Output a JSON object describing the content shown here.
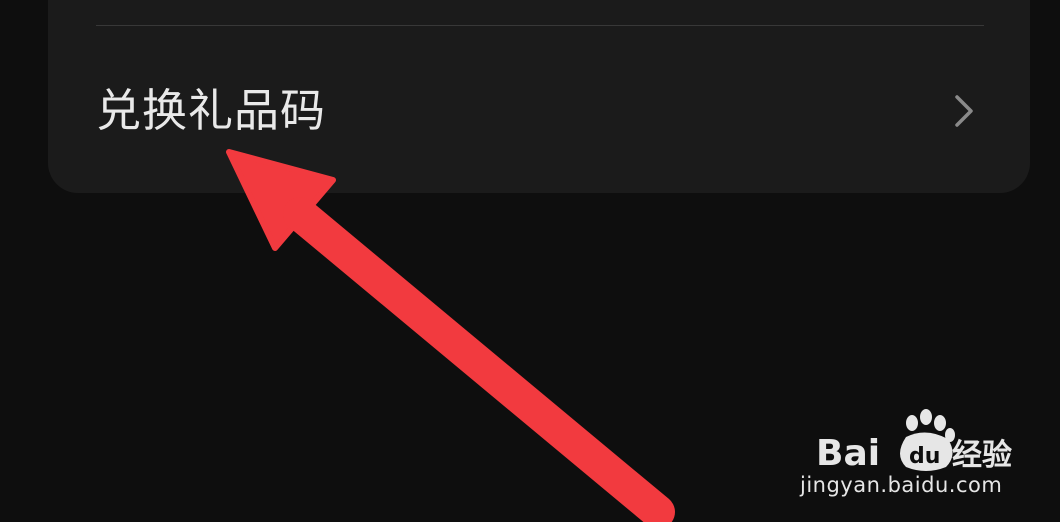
{
  "settings_list": {
    "items": [
      {
        "label": "兑换礼品码",
        "icon": "chevron-right-icon"
      }
    ]
  },
  "annotation": {
    "arrow_color": "#f23a3f",
    "icon": "pointer-arrow-icon"
  },
  "watermark": {
    "brand": "Baidu经验",
    "url": "jingyan.baidu.com",
    "icon": "baidu-paw-icon"
  },
  "colors": {
    "background": "#0e0e0e",
    "card": "#1b1b1b",
    "text": "#e9e9e9",
    "chevron": "#8a8a8a",
    "divider": "#383838"
  }
}
